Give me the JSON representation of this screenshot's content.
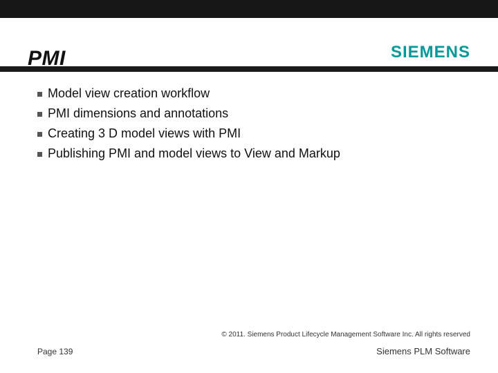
{
  "header": {
    "title": "PMI",
    "logo": "SIEMENS"
  },
  "bullets": [
    "Model view creation workflow",
    "PMI dimensions and annotations",
    "Creating 3 D model views with PMI",
    "Publishing PMI and model views to View and Markup"
  ],
  "footer": {
    "copyright": "© 2011. Siemens Product Lifecycle Management Software Inc. All rights reserved",
    "page": "Page 139",
    "brand": "Siemens PLM Software"
  }
}
